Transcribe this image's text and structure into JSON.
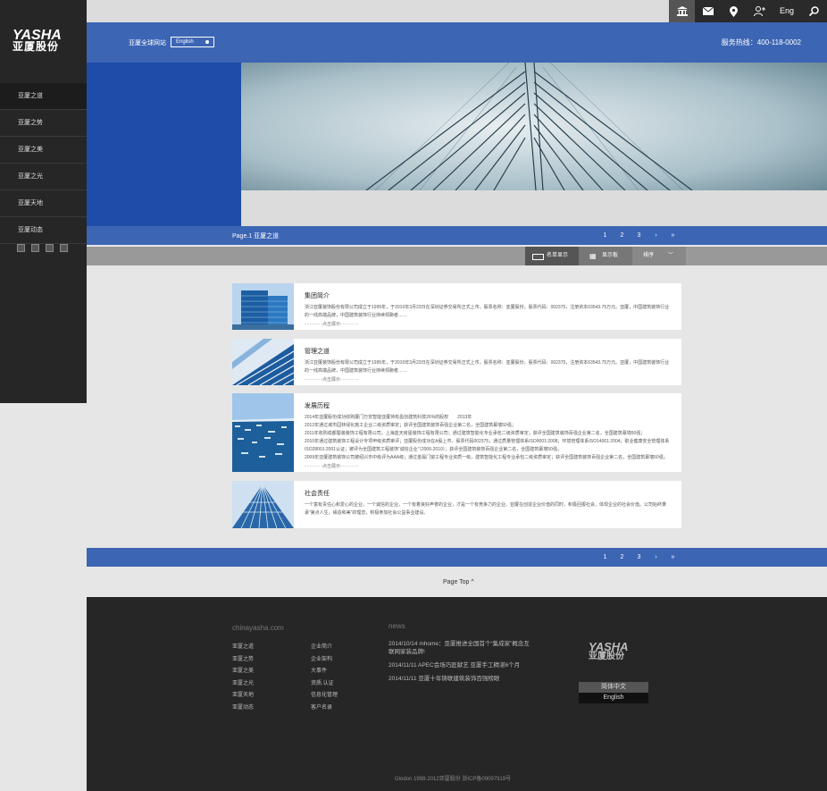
{
  "logo": {
    "en": "YASHA",
    "cn": "亚厦股份"
  },
  "sidebar": {
    "items": [
      "亚厦之道",
      "亚厦之势",
      "亚厦之美",
      "亚厦之光",
      "亚厦天地",
      "亚厦动态"
    ]
  },
  "topbar": {
    "eng_label": "Eng"
  },
  "header": {
    "global_label": "亚厦全球网站",
    "language_selected": "English",
    "hotline": "服务热线：400-118-0002"
  },
  "pager": {
    "title": "Page.1 亚厦之道",
    "pages": [
      "1",
      "2",
      "3",
      "›",
      "»"
    ]
  },
  "view": {
    "list_label": "名单显示",
    "grid_label": "显示板",
    "sort_label": "排序"
  },
  "cards": [
    {
      "title": "集团简介",
      "text": "浙江亚厦装饰股份有限公司成立于1995年，于2010年3月23日在深圳证券交易所正式上市，股票名称：亚厦股份，股票代码：002375，注册资本63543.75万元。亚厦，中国建筑装饰行业的一线高端品牌，中国建筑装饰行业持续领跑者……",
      "more": "- - - - - - -点击展示- - - - - - -"
    },
    {
      "title": "管理之道",
      "text": "浙江亚厦装饰股份有限公司成立于1995年，于2010年3月23日在深圳证券交易所正式上市，股票名称：亚厦股份，股票代码：002375，注册资本63543.75万元。亚厦，中国建筑装饰行业的一线高端品牌，中国建筑装饰行业持续领跑者……",
      "more": "- - - - - - -点击展示- - - - - - -"
    },
    {
      "title": "发展历程",
      "lines": [
        "2014年亚厦股份成功收购厦门万安智能亚厦持有盈创建筑科技26%的股权　　2013年",
        "2012年通过城市园林绿化施工企业二级资质审定；获评全国建筑装饰百强企业第二名，全国建筑幕墙50强；",
        "2011年收购成都蜀装装饰工程有限公司，上海蓝天房屋装饰工程有限公司；通过建筑智能化专业承包二级资质审定；获评全国建筑装饰百强企业第二名，全国建筑幕墙50强；",
        "2010年通过建筑装饰工程设计专项甲级资质审评；亚厦股份成功在A股上市，股票代码002375；通过质量管理体系ISO9001:2008；环境管理体系ISO14001:2004；职业健康安全管理体系ISO28001:2001认证；被评为全国建筑工程装饰“诚信企业”（2006-2010）；获评全国建筑装饰百强企业第二名，全国建筑幕墙50强；",
        "2009年亚厦建筑装饰公司被绍兴市中级评为AAA级；通过金属门窗工程专业资质一级，建筑智能化工程专业承包二级资质审定；获评全国建筑装饰百强企业第二名，全国建筑幕墙50强；"
      ],
      "more": "- - - - - - -点击展示- - - - - - -"
    },
    {
      "title": "社会责任",
      "text": "一个富有责任心和爱心的企业，一个诚信的企业，一个有着良好声誉的企业，才是一个有竞争力的企业。亚厦在创造企业价值的同时，积极回报社会，体现企业的社会价值。公司始终秉承“第点人生，缘造和美”的理念，积极参加社会公益事业建设。"
    }
  ],
  "page_top": "Page Top ^",
  "footer": {
    "site": "chinayasha.com",
    "col1": [
      "亚厦之道",
      "亚厦之势",
      "亚厦之美",
      "亚厦之光",
      "亚厦天地",
      "亚厦动态"
    ],
    "col2": [
      "企业简介",
      "企业架构",
      "大事件",
      "资质.认证",
      "信息化管理",
      "客户名录"
    ],
    "news_heading": "news",
    "news": [
      "2014/10/14 mhome：亚厦推进全国首个“集成家”概念互联网家装品牌!",
      "2014/11/11 APEC会场巧匠献艺 亚厦手工精湛6个月",
      "2014/11/11 亚厦十年铸联建筑装饰百强榜眼"
    ],
    "lang_cn": "简体中文",
    "lang_en": "English",
    "copyright": "Glodon 1998-2012亚厦股份 浙ICP备09097919号"
  }
}
